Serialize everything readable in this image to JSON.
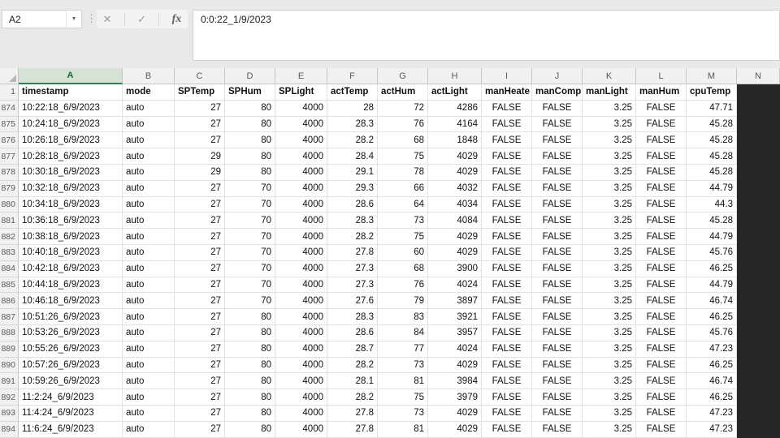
{
  "formula_bar": {
    "name_box": "A2",
    "dropdown_icon": "name-box-dropdown",
    "cancel_icon": "cancel",
    "enter_icon": "enter",
    "fx_icon": "insert-function",
    "fx_label": "fx",
    "formula": "0:0:22_1/9/2023"
  },
  "grid": {
    "column_letters": [
      "A",
      "B",
      "C",
      "D",
      "E",
      "F",
      "G",
      "H",
      "I",
      "J",
      "K",
      "L",
      "M",
      "N"
    ],
    "selected_column": "A",
    "alignments": [
      "left",
      "left",
      "right",
      "right",
      "right",
      "right",
      "right",
      "right",
      "center",
      "center",
      "right",
      "center",
      "right"
    ],
    "field_row": {
      "number": "1",
      "cells": [
        "timestamp",
        "mode",
        "SPTemp",
        "SPHum",
        "SPLight",
        "actTemp",
        "actHum",
        "actLight",
        "manHeate",
        "manComp",
        "manLight",
        "manHum",
        "cpuTemp"
      ]
    },
    "rows": [
      {
        "number": "874",
        "cells": [
          "10:22:18_6/9/2023",
          "auto",
          "27",
          "80",
          "4000",
          "28",
          "72",
          "4286",
          "FALSE",
          "FALSE",
          "3.25",
          "FALSE",
          "47.71"
        ]
      },
      {
        "number": "875",
        "cells": [
          "10:24:18_6/9/2023",
          "auto",
          "27",
          "80",
          "4000",
          "28.3",
          "76",
          "4164",
          "FALSE",
          "FALSE",
          "3.25",
          "FALSE",
          "45.28"
        ]
      },
      {
        "number": "876",
        "cells": [
          "10:26:18_6/9/2023",
          "auto",
          "27",
          "80",
          "4000",
          "28.2",
          "68",
          "1848",
          "FALSE",
          "FALSE",
          "3.25",
          "FALSE",
          "45.28"
        ]
      },
      {
        "number": "877",
        "cells": [
          "10:28:18_6/9/2023",
          "auto",
          "29",
          "80",
          "4000",
          "28.4",
          "75",
          "4029",
          "FALSE",
          "FALSE",
          "3.25",
          "FALSE",
          "45.28"
        ]
      },
      {
        "number": "878",
        "cells": [
          "10:30:18_6/9/2023",
          "auto",
          "29",
          "80",
          "4000",
          "29.1",
          "78",
          "4029",
          "FALSE",
          "FALSE",
          "3.25",
          "FALSE",
          "45.28"
        ]
      },
      {
        "number": "879",
        "cells": [
          "10:32:18_6/9/2023",
          "auto",
          "27",
          "70",
          "4000",
          "29.3",
          "66",
          "4032",
          "FALSE",
          "FALSE",
          "3.25",
          "FALSE",
          "44.79"
        ]
      },
      {
        "number": "880",
        "cells": [
          "10:34:18_6/9/2023",
          "auto",
          "27",
          "70",
          "4000",
          "28.6",
          "64",
          "4034",
          "FALSE",
          "FALSE",
          "3.25",
          "FALSE",
          "44.3"
        ]
      },
      {
        "number": "881",
        "cells": [
          "10:36:18_6/9/2023",
          "auto",
          "27",
          "70",
          "4000",
          "28.3",
          "73",
          "4084",
          "FALSE",
          "FALSE",
          "3.25",
          "FALSE",
          "45.28"
        ]
      },
      {
        "number": "882",
        "cells": [
          "10:38:18_6/9/2023",
          "auto",
          "27",
          "70",
          "4000",
          "28.2",
          "75",
          "4029",
          "FALSE",
          "FALSE",
          "3.25",
          "FALSE",
          "44.79"
        ]
      },
      {
        "number": "883",
        "cells": [
          "10:40:18_6/9/2023",
          "auto",
          "27",
          "70",
          "4000",
          "27.8",
          "60",
          "4029",
          "FALSE",
          "FALSE",
          "3.25",
          "FALSE",
          "45.76"
        ]
      },
      {
        "number": "884",
        "cells": [
          "10:42:18_6/9/2023",
          "auto",
          "27",
          "70",
          "4000",
          "27.3",
          "68",
          "3900",
          "FALSE",
          "FALSE",
          "3.25",
          "FALSE",
          "46.25"
        ]
      },
      {
        "number": "885",
        "cells": [
          "10:44:18_6/9/2023",
          "auto",
          "27",
          "70",
          "4000",
          "27.3",
          "76",
          "4024",
          "FALSE",
          "FALSE",
          "3.25",
          "FALSE",
          "44.79"
        ]
      },
      {
        "number": "886",
        "cells": [
          "10:46:18_6/9/2023",
          "auto",
          "27",
          "70",
          "4000",
          "27.6",
          "79",
          "3897",
          "FALSE",
          "FALSE",
          "3.25",
          "FALSE",
          "46.74"
        ]
      },
      {
        "number": "887",
        "cells": [
          "10:51:26_6/9/2023",
          "auto",
          "27",
          "80",
          "4000",
          "28.3",
          "83",
          "3921",
          "FALSE",
          "FALSE",
          "3.25",
          "FALSE",
          "46.25"
        ]
      },
      {
        "number": "888",
        "cells": [
          "10:53:26_6/9/2023",
          "auto",
          "27",
          "80",
          "4000",
          "28.6",
          "84",
          "3957",
          "FALSE",
          "FALSE",
          "3.25",
          "FALSE",
          "45.76"
        ]
      },
      {
        "number": "889",
        "cells": [
          "10:55:26_6/9/2023",
          "auto",
          "27",
          "80",
          "4000",
          "28.7",
          "77",
          "4024",
          "FALSE",
          "FALSE",
          "3.25",
          "FALSE",
          "47.23"
        ]
      },
      {
        "number": "890",
        "cells": [
          "10:57:26_6/9/2023",
          "auto",
          "27",
          "80",
          "4000",
          "28.2",
          "73",
          "4029",
          "FALSE",
          "FALSE",
          "3.25",
          "FALSE",
          "46.25"
        ]
      },
      {
        "number": "891",
        "cells": [
          "10:59:26_6/9/2023",
          "auto",
          "27",
          "80",
          "4000",
          "28.1",
          "81",
          "3984",
          "FALSE",
          "FALSE",
          "3.25",
          "FALSE",
          "46.74"
        ]
      },
      {
        "number": "892",
        "cells": [
          "11:2:24_6/9/2023",
          "auto",
          "27",
          "80",
          "4000",
          "28.2",
          "75",
          "3979",
          "FALSE",
          "FALSE",
          "3.25",
          "FALSE",
          "46.25"
        ]
      },
      {
        "number": "893",
        "cells": [
          "11:4:24_6/9/2023",
          "auto",
          "27",
          "80",
          "4000",
          "27.8",
          "73",
          "4029",
          "FALSE",
          "FALSE",
          "3.25",
          "FALSE",
          "47.23"
        ]
      },
      {
        "number": "894",
        "cells": [
          "11:6:24_6/9/2023",
          "auto",
          "27",
          "80",
          "4000",
          "27.8",
          "81",
          "4029",
          "FALSE",
          "FALSE",
          "3.25",
          "FALSE",
          "47.23"
        ]
      }
    ]
  }
}
